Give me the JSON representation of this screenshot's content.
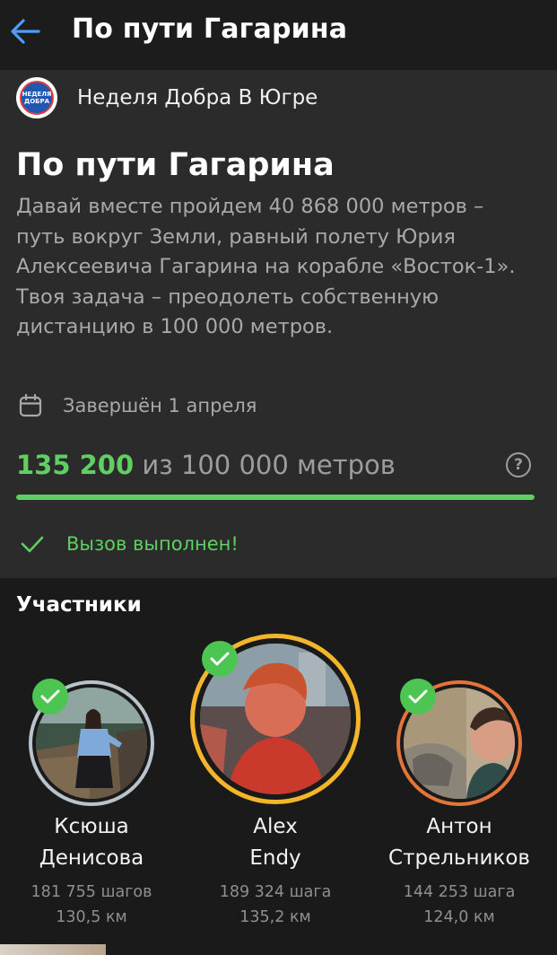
{
  "header": {
    "title": "По пути Гагарина",
    "back_icon": "arrow-left-icon",
    "accent_color": "#4d9df7"
  },
  "organizer": {
    "name": "Неделя Добра В Югре",
    "logo_text_line1": "НЕДЕЛЯ",
    "logo_text_line2": "ДОБРА"
  },
  "challenge": {
    "title": "По пути Гагарина",
    "description": "Давай вместе пройдем 40 868 000 метров – путь вокруг Земли, равный полету Юрия Алексеевича Гагарина на корабле «Восток-1». Твоя задача – преодолеть собственную дистанцию в 100 000 метров.",
    "date_icon": "calendar-icon",
    "date_text": "Завершён 1 апреля",
    "progress_done": "135 200",
    "progress_rest": " из 100 000 метров",
    "help_symbol": "?",
    "progress_fraction": 1.0,
    "status_icon": "checkmark-icon",
    "status_text": "Вызов выполнен!",
    "accent_green": "#5fcf62"
  },
  "participants_section": {
    "title": "Участники",
    "items": [
      {
        "name_line1": "Ксюша",
        "name_line2": "Денисова",
        "steps": "181 755 шагов",
        "distance": "130,5 км",
        "ring_color": "#b9c3cc",
        "completed": true
      },
      {
        "name_line1": "Alex",
        "name_line2": "Endy",
        "steps": "189 324 шага",
        "distance": "135,2 км",
        "ring_color": "#f3b52a",
        "completed": true
      },
      {
        "name_line1": "Антон",
        "name_line2": "Стрельников",
        "steps": "144 253 шага",
        "distance": "124,0 км",
        "ring_color": "#e3743a",
        "completed": true
      }
    ]
  }
}
